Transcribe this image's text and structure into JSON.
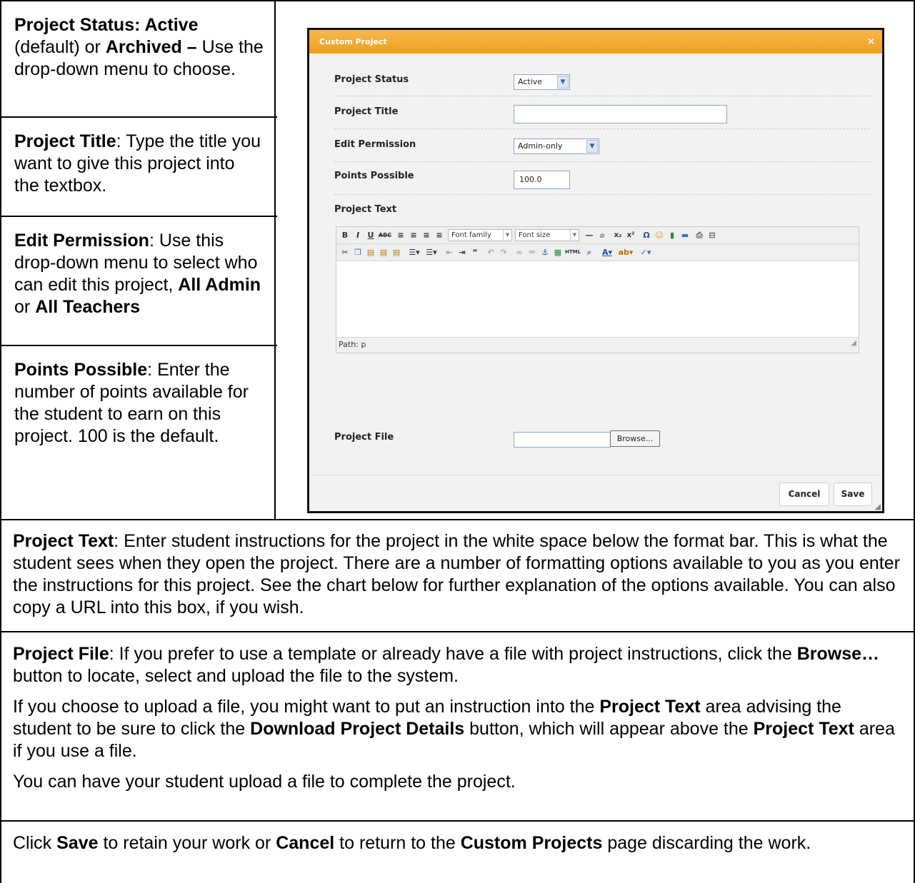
{
  "left_cells": {
    "status": {
      "title": "Project Status",
      "colon": ": ",
      "active": "Active",
      "mid": " (default) or ",
      "archived": "Archived –",
      "rest": " Use the drop-down menu to choose."
    },
    "title": {
      "title": "Project Title",
      "rest": ": Type the title you want to give this project into the textbox."
    },
    "permission": {
      "title": "Edit Permission",
      "rest": ": Use this drop-down menu to select who can edit this project, ",
      "opt1": "All Admin",
      "mid": " or ",
      "opt2": "All Teachers"
    },
    "points": {
      "title": "Points Possible",
      "rest": ": Enter the number of points available for the student to earn on this project. 100 is the default."
    }
  },
  "dialog": {
    "title": "Custom Project",
    "close": "×",
    "status_label": "Project Status",
    "status_value": "Active",
    "title_label": "Project Title",
    "title_value": "",
    "permission_label": "Edit Permission",
    "permission_value": "Admin-only",
    "points_label": "Points Possible",
    "points_value": "100.0",
    "text_label": "Project Text",
    "font_family": "Font family",
    "font_size": "Font size",
    "path": "Path: p",
    "file_label": "Project File",
    "browse": "Browse...",
    "cancel": "Cancel",
    "save": "Save"
  },
  "rows": {
    "text": {
      "title": "Project Text",
      "rest": ": Enter student instructions for the project in the white space below the format bar. This is what the student sees when they open the project. There are a number of formatting options available to you as you enter the instructions for this project. See the chart below for further explanation of the options available. You can also copy a URL into this box, if you wish."
    },
    "file": {
      "title": "Project File",
      "p1a": ": If you prefer to use a template or already have a file with project instructions, click the ",
      "browse": "Browse…",
      "p1b": " button to locate, select and upload the file to the system.",
      "p2a": "If you choose to upload a file, you might want to put an instruction into the ",
      "p2_text": "Project Text",
      "p2b": " area advising the student to be sure to click the ",
      "p2_download": "Download Project Details",
      "p2c": " button, which will appear above the ",
      "p2_text2": "Project Text",
      "p2d": " area if you use a file.",
      "p3": "You can have your student upload a file to complete the project."
    },
    "save": {
      "a": "Click ",
      "save": "Save",
      "b": " to retain your work or ",
      "cancel": "Cancel",
      "c": " to return to the ",
      "custom": "Custom Projects",
      "d": " page discarding the work."
    }
  },
  "colors": {
    "header_orange": "#f0a02a",
    "border": "#000000"
  }
}
